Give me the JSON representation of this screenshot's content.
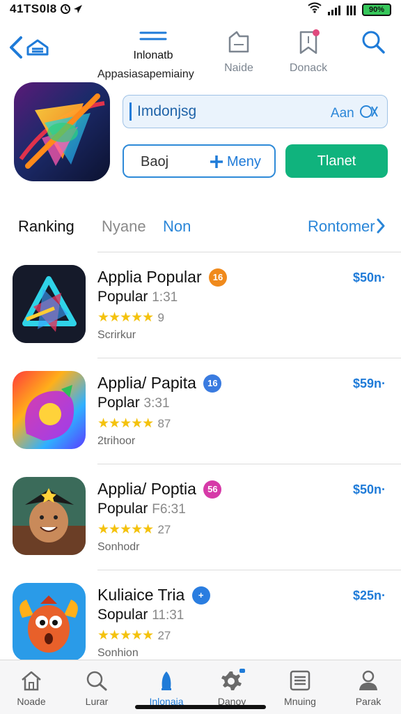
{
  "status_bar": {
    "time": "41TS0l8",
    "battery_label": "90%",
    "battery_color": "#36c75a"
  },
  "nav": {
    "back_icon": "back-chevron-store-icon",
    "center_title": "Inlonatb",
    "center_subtitle": "Appasiasapemiainy",
    "actions": [
      {
        "icon": "bookmark-hand-icon",
        "label": "Naide"
      },
      {
        "icon": "bookmark-flag-icon",
        "label": "Donack"
      },
      {
        "icon": "search-icon",
        "label": ""
      }
    ]
  },
  "app_header": {
    "search_value": "Imdonjsg",
    "search_aux": "Aan",
    "outline_button_left": "Baoj",
    "outline_button_right": "Meny",
    "green_button": "Tlanet",
    "accent_color": "#10b37d"
  },
  "tabs": {
    "items": [
      "Ranking",
      "Nyane",
      "Non"
    ],
    "right_link": "Rontomer"
  },
  "apps": [
    {
      "title": "Applia Popular",
      "badge": "16",
      "badge_color": "#f08a1c",
      "subtitle": "Popular",
      "subtitle_extra": "1:31",
      "stars": "★★★★★",
      "rating": "9",
      "meta": "Scrirkur",
      "price": "$50n·"
    },
    {
      "title": "Applia/ Papita",
      "badge": "16",
      "badge_color": "#3a7be0",
      "subtitle": "Poplar",
      "subtitle_extra": "3:31",
      "stars": "★★★★★",
      "rating": "87",
      "meta": "2trihoor",
      "price": "$59n·"
    },
    {
      "title": "Applia/ Poptia",
      "badge": "56",
      "badge_color": "#d63aa8",
      "subtitle": "Popular",
      "subtitle_extra": "F6:31",
      "stars": "★★★★★",
      "rating": "27",
      "meta": "Sonhodr",
      "price": "$50n·"
    },
    {
      "title": "Kuliaice Tria",
      "badge": "+",
      "badge_color": "#2a7de0",
      "subtitle": "Sopular",
      "subtitle_extra": "11:31",
      "stars": "★★★★★",
      "rating": "27",
      "meta": "Sonhion",
      "price": "$25n·"
    }
  ],
  "bottom_tabs": [
    {
      "icon": "home-icon",
      "label": "Noade"
    },
    {
      "icon": "search-icon",
      "label": "Lurar"
    },
    {
      "icon": "rocket-icon",
      "label": "Inlonaia",
      "active": true
    },
    {
      "icon": "gear-badge-icon",
      "label": "Danoy"
    },
    {
      "icon": "list-doc-icon",
      "label": "Mnuing"
    },
    {
      "icon": "person-icon",
      "label": "Parak"
    }
  ]
}
